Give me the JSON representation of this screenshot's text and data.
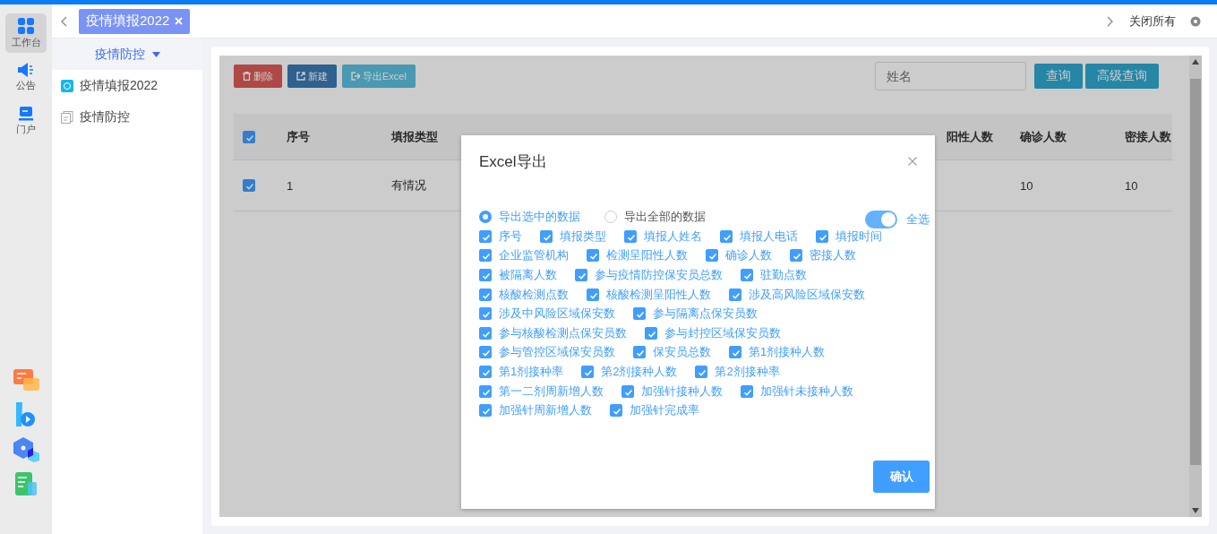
{
  "rail": {
    "items": [
      {
        "label": "工作台",
        "selected": true
      },
      {
        "label": "公告",
        "selected": false
      },
      {
        "label": "门户",
        "selected": false
      }
    ]
  },
  "tabs": [
    {
      "label": "疫情填报2022",
      "selected": true
    }
  ],
  "tab_bar": {
    "close_all": "关闭所有"
  },
  "sidebar": {
    "title": "疫情防控",
    "items": [
      {
        "label": "疫情填报2022",
        "kind": "app"
      },
      {
        "label": "疫情防控",
        "kind": "doc"
      }
    ]
  },
  "toolbar": {
    "buttons": [
      {
        "label": "删除",
        "kind": "danger"
      },
      {
        "label": "新建",
        "kind": "primary"
      },
      {
        "label": "导出Excel",
        "kind": "info"
      }
    ],
    "search": {
      "placeholder": "姓名"
    },
    "actions": [
      "查询",
      "高级查询"
    ]
  },
  "table": {
    "select_all": true,
    "columns": [
      "序号",
      "填报类型",
      "阳性人数",
      "确诊人数",
      "密接人数"
    ],
    "rows": [
      {
        "checked": true,
        "cells": [
          "1",
          "有情况",
          "",
          "10",
          "10"
        ]
      }
    ]
  },
  "dialog": {
    "title": "Excel导出",
    "scope": [
      {
        "label": "导出选中的数据",
        "selected": true
      },
      {
        "label": "导出全部的数据",
        "selected": false
      }
    ],
    "select_all": {
      "label": "全选",
      "on": true
    },
    "fields": [
      {
        "label": "序号",
        "checked": true
      },
      {
        "label": "填报类型",
        "checked": true
      },
      {
        "label": "填报人姓名",
        "checked": true
      },
      {
        "label": "填报人电话",
        "checked": true
      },
      {
        "label": "填报时间",
        "checked": true
      },
      {
        "label": "企业监管机构",
        "checked": true
      },
      {
        "label": "检测呈阳性人数",
        "checked": true
      },
      {
        "label": "确诊人数",
        "checked": true
      },
      {
        "label": "密接人数",
        "checked": true
      },
      {
        "label": "被隔离人数",
        "checked": true
      },
      {
        "label": "参与疫情防控保安员总数",
        "checked": true
      },
      {
        "label": "驻勤点数",
        "checked": true
      },
      {
        "label": "核酸检测点数",
        "checked": true
      },
      {
        "label": "核酸检测呈阳性人数",
        "checked": true
      },
      {
        "label": "涉及高风险区域保安数",
        "checked": true
      },
      {
        "label": "涉及中风险区域保安数",
        "checked": true
      },
      {
        "label": "参与隔离点保安员数",
        "checked": true
      },
      {
        "label": "参与核酸检测点保安员数",
        "checked": true
      },
      {
        "label": "参与封控区域保安员数",
        "checked": true
      },
      {
        "label": "参与管控区域保安员数",
        "checked": true
      },
      {
        "label": "保安员总数",
        "checked": true
      },
      {
        "label": "第1剂接种人数",
        "checked": true
      },
      {
        "label": "第1剂接种率",
        "checked": true
      },
      {
        "label": "第2剂接种人数",
        "checked": true
      },
      {
        "label": "第2剂接种率",
        "checked": true
      },
      {
        "label": "第一二剂周新增人数",
        "checked": true
      },
      {
        "label": "加强针接种人数",
        "checked": true
      },
      {
        "label": "加强针未接种人数",
        "checked": true
      },
      {
        "label": "加强针周新增人数",
        "checked": true
      },
      {
        "label": "加强针完成率",
        "checked": true
      }
    ],
    "confirm": "确认"
  }
}
